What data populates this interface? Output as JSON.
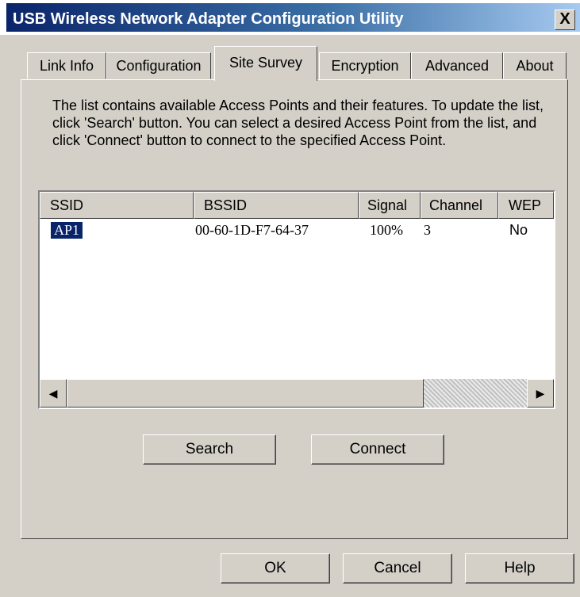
{
  "window": {
    "title": "USB Wireless Network Adapter Configuration Utility",
    "close_label": "X"
  },
  "tabs": [
    {
      "label": "Link Info"
    },
    {
      "label": "Configuration"
    },
    {
      "label": "Site Survey",
      "active": true
    },
    {
      "label": "Encryption"
    },
    {
      "label": "Advanced"
    },
    {
      "label": "About"
    }
  ],
  "description": "The list contains available Access Points and their features. To update the list, click 'Search' button. You can select a desired Access Point from the list, and click 'Connect' button to connect to the specified Access Point.",
  "list": {
    "columns": [
      "SSID",
      "BSSID",
      "Signal",
      "Channel",
      "WEP"
    ],
    "rows": [
      {
        "ssid": "AP1",
        "bssid": "00-60-1D-F7-64-37",
        "signal": "100%",
        "channel": "3",
        "wep": "No",
        "selected": true
      }
    ],
    "scroll_left": "◀",
    "scroll_right": "▶"
  },
  "buttons": {
    "search": "Search",
    "connect": "Connect",
    "ok": "OK",
    "cancel": "Cancel",
    "help": "Help"
  },
  "colors": {
    "title_gradient_start": "#0a246a",
    "title_gradient_end": "#a6caf0",
    "face": "#d4d0c8",
    "selection": "#0a246a"
  }
}
